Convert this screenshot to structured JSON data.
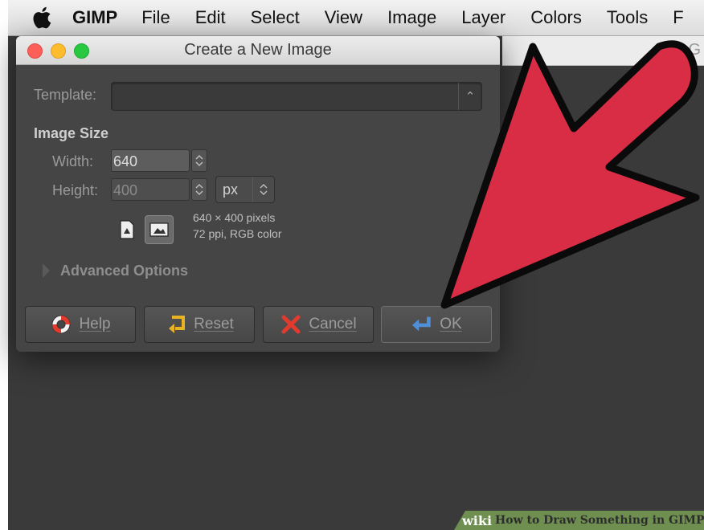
{
  "menubar": {
    "apple": "apple-icon",
    "items": [
      "GIMP",
      "File",
      "Edit",
      "Select",
      "View",
      "Image",
      "Layer",
      "Colors",
      "Tools",
      "F"
    ]
  },
  "dialog": {
    "title": "Create a New Image",
    "template_label": "Template:",
    "template_value": "",
    "image_size_heading": "Image Size",
    "width_label": "Width:",
    "width_value": "640",
    "height_label": "Height:",
    "height_value": "400",
    "unit": "px",
    "info_line1": "640 × 400 pixels",
    "info_line2": "72 ppi, RGB color",
    "advanced_label": "Advanced Options",
    "buttons": {
      "help": "Help",
      "reset": "Reset",
      "cancel": "Cancel",
      "ok": "OK"
    }
  },
  "canvas_partial": "G",
  "watermark": {
    "brand": "wiki",
    "text": "How to Draw Something in GIMP"
  },
  "colors": {
    "arrow": "#d92d45",
    "dialog_bg": "#454545",
    "canvas_bg": "#3a3a3a"
  }
}
